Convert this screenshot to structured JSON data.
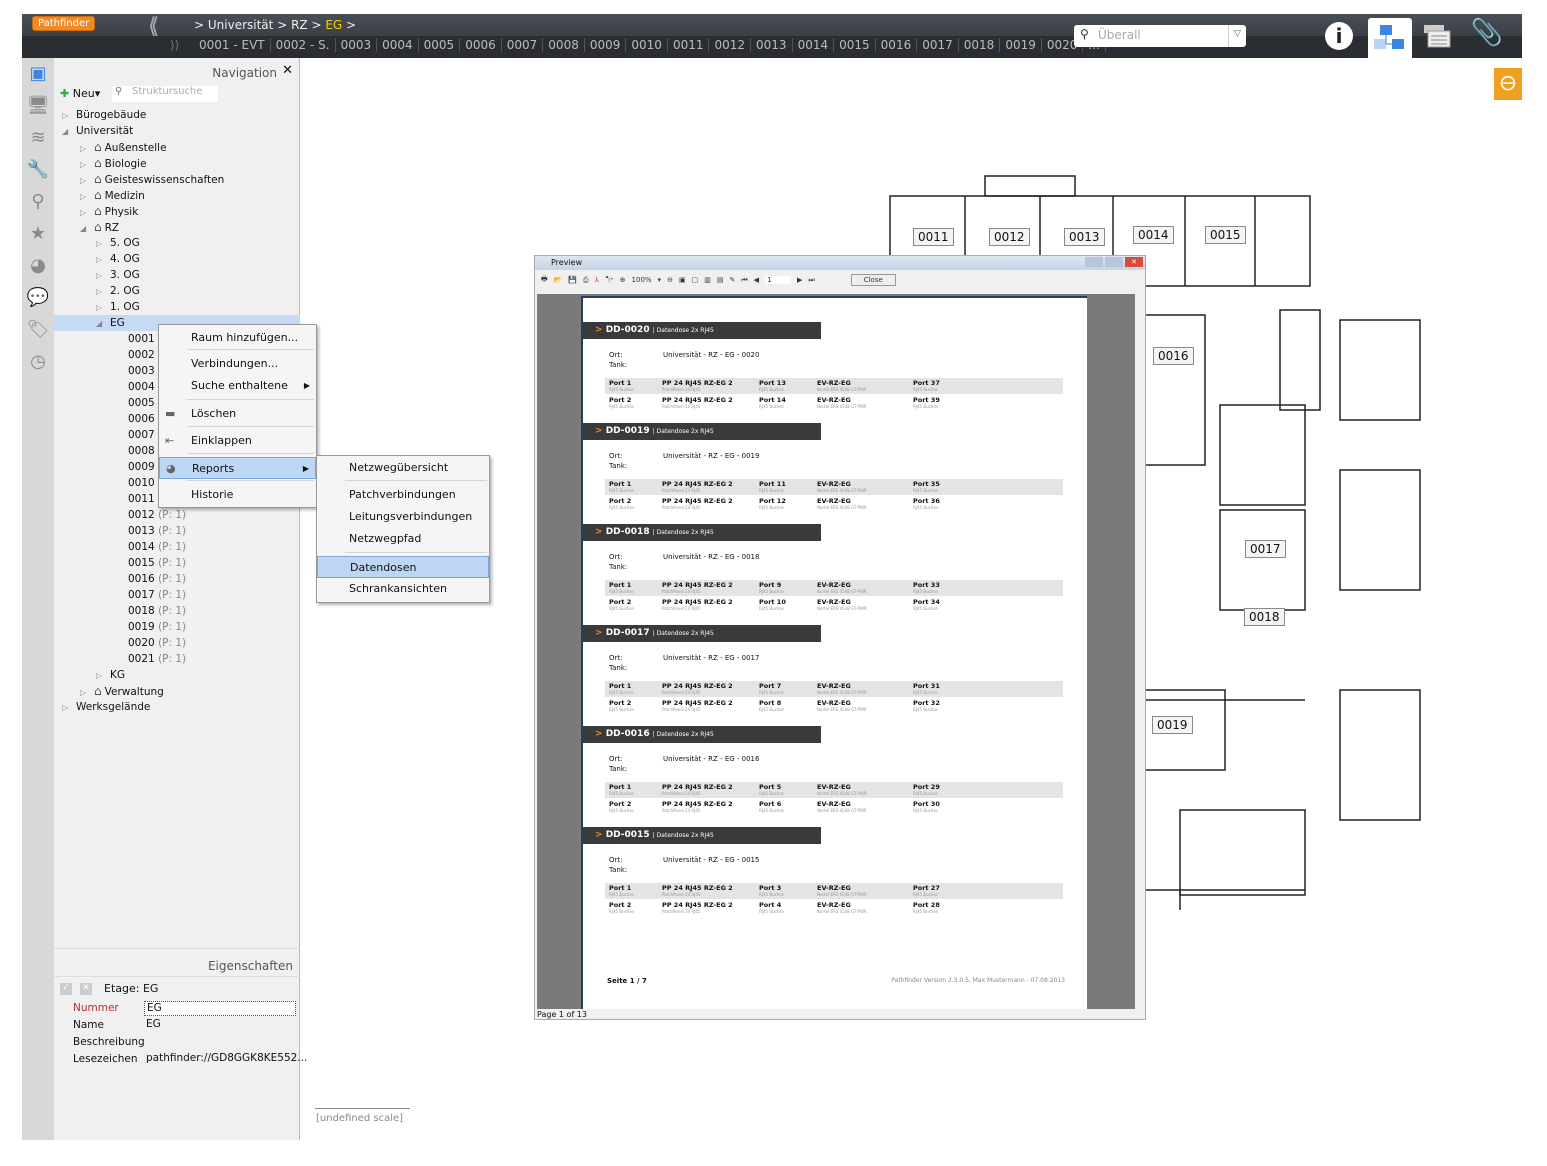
{
  "app": {
    "logo": "Pathfinder",
    "breadcrumb": [
      "Universität",
      "RZ",
      "EG"
    ],
    "tabs": [
      "0001 - EVT",
      "0002 - S.",
      "0003",
      "0004",
      "0005",
      "0006",
      "0007",
      "0008",
      "0009",
      "0010",
      "0011",
      "0012",
      "0013",
      "0014",
      "0015",
      "0016",
      "0017",
      "0018",
      "0019",
      "0020",
      "..."
    ],
    "search_placeholder": "Überall",
    "accent": "#f08a24"
  },
  "nav": {
    "title": "Navigation",
    "new_label": "Neu",
    "search_placeholder": "Struktursuche",
    "tree": [
      {
        "l": 0,
        "t": "Bürogebäude",
        "tw": "▷"
      },
      {
        "l": 0,
        "t": "Universität",
        "tw": "◢"
      },
      {
        "l": 1,
        "t": "Außenstelle",
        "tw": "▷",
        "h": 1
      },
      {
        "l": 1,
        "t": "Biologie",
        "tw": "▷",
        "h": 1
      },
      {
        "l": 1,
        "t": "Geisteswissenschaften",
        "tw": "▷",
        "h": 1
      },
      {
        "l": 1,
        "t": "Medizin",
        "tw": "▷",
        "h": 1
      },
      {
        "l": 1,
        "t": "Physik",
        "tw": "▷",
        "h": 1
      },
      {
        "l": 1,
        "t": "RZ",
        "tw": "◢",
        "h": 1
      },
      {
        "l": 2,
        "t": "5. OG",
        "tw": "▷"
      },
      {
        "l": 2,
        "t": "4. OG",
        "tw": "▷"
      },
      {
        "l": 2,
        "t": "3. OG",
        "tw": "▷"
      },
      {
        "l": 2,
        "t": "2. OG",
        "tw": "▷"
      },
      {
        "l": 2,
        "t": "1. OG",
        "tw": "▷"
      },
      {
        "l": 2,
        "t": "EG",
        "tw": "◢",
        "sel": 1
      },
      {
        "l": 3,
        "t": "0001"
      },
      {
        "l": 3,
        "t": "0002"
      },
      {
        "l": 3,
        "t": "0003"
      },
      {
        "l": 3,
        "t": "0004"
      },
      {
        "l": 3,
        "t": "0005"
      },
      {
        "l": 3,
        "t": "0006"
      },
      {
        "l": 3,
        "t": "0007"
      },
      {
        "l": 3,
        "t": "0008"
      },
      {
        "l": 3,
        "t": "0009"
      },
      {
        "l": 3,
        "t": "0010"
      },
      {
        "l": 3,
        "t": "0011"
      },
      {
        "l": 3,
        "t": "0012",
        "p": "(P: 1)"
      },
      {
        "l": 3,
        "t": "0013",
        "p": "(P: 1)"
      },
      {
        "l": 3,
        "t": "0014",
        "p": "(P: 1)"
      },
      {
        "l": 3,
        "t": "0015",
        "p": "(P: 1)"
      },
      {
        "l": 3,
        "t": "0016",
        "p": "(P: 1)"
      },
      {
        "l": 3,
        "t": "0017",
        "p": "(P: 1)"
      },
      {
        "l": 3,
        "t": "0018",
        "p": "(P: 1)"
      },
      {
        "l": 3,
        "t": "0019",
        "p": "(P: 1)"
      },
      {
        "l": 3,
        "t": "0020",
        "p": "(P: 1)"
      },
      {
        "l": 3,
        "t": "0021",
        "p": "(P: 1)"
      },
      {
        "l": 2,
        "t": "KG",
        "tw": "▷"
      },
      {
        "l": 1,
        "t": "Verwaltung",
        "tw": "▷",
        "h": 1
      },
      {
        "l": 0,
        "t": "Werksgelände",
        "tw": "▷"
      }
    ]
  },
  "context_menu": [
    "Raum hinzufügen...",
    "Verbindungen...",
    "Suche enthaltene",
    "Löschen",
    "Einklappen",
    "Reports",
    "Historie"
  ],
  "submenu": [
    "Netzwegübersicht",
    "Patchverbindungen",
    "Leitungsverbindungen",
    "Netzwegpfad",
    "Datendosen",
    "Schrankansichten"
  ],
  "properties": {
    "title": "Eigenschaften",
    "object": "Etage: EG",
    "rows": [
      [
        "Nummer",
        "EG"
      ],
      [
        "Name",
        "EG"
      ],
      [
        "Beschreibung",
        ""
      ],
      [
        "Lesezeichen",
        "pathfinder://GD8GGK8KE552..."
      ]
    ]
  },
  "preview": {
    "title": "Preview",
    "zoom": "100%",
    "page_input": "1",
    "close_label": "Close",
    "status": "Page 1 of 13",
    "page_footer_left": "Seite 1 / 7",
    "page_footer_right": "Pathfinder Version 2.3.0.5, Max Mustermann - 07.08.2013",
    "labels": {
      "ort": "Ort:",
      "tank": "Tank:",
      "subtitle": "| Datendose 2x RJ45",
      "rj45": "RJ45 Buchse",
      "pp_sub": "PatchPanel 24 RJ45",
      "sw_sub": "Nortel ERS 4548 GT-PWR",
      "pp": "PP 24 RJ45 RZ-EG 2",
      "sw": "EV-RZ-EG"
    },
    "blocks": [
      {
        "id": "DD-0020",
        "ort": "Universität - RZ - EG - 0020",
        "rows": [
          [
            "Port 1",
            "Port 13",
            "Port 37"
          ],
          [
            "Port 2",
            "Port 14",
            "Port 39"
          ]
        ]
      },
      {
        "id": "DD-0019",
        "ort": "Universität - RZ - EG - 0019",
        "rows": [
          [
            "Port 1",
            "Port 11",
            "Port 35"
          ],
          [
            "Port 2",
            "Port 12",
            "Port 36"
          ]
        ]
      },
      {
        "id": "DD-0018",
        "ort": "Universität - RZ - EG - 0018",
        "rows": [
          [
            "Port 1",
            "Port 9",
            "Port 33"
          ],
          [
            "Port 2",
            "Port 10",
            "Port 34"
          ]
        ]
      },
      {
        "id": "DD-0017",
        "ort": "Universität - RZ - EG - 0017",
        "rows": [
          [
            "Port 1",
            "Port 7",
            "Port 31"
          ],
          [
            "Port 2",
            "Port 8",
            "Port 32"
          ]
        ]
      },
      {
        "id": "DD-0016",
        "ort": "Universität - RZ - EG - 0016",
        "rows": [
          [
            "Port 1",
            "Port 5",
            "Port 29"
          ],
          [
            "Port 2",
            "Port 6",
            "Port 30"
          ]
        ]
      },
      {
        "id": "DD-0015",
        "ort": "Universität - RZ - EG - 0015",
        "rows": [
          [
            "Port 1",
            "Port 3",
            "Port 27"
          ],
          [
            "Port 2",
            "Port 4",
            "Port 28"
          ]
        ]
      }
    ]
  },
  "floorplan": {
    "rooms": [
      "0011",
      "0012",
      "0013",
      "0014",
      "0015",
      "0016",
      "0017",
      "0018",
      "0019"
    ],
    "scale": "[undefined scale]"
  }
}
